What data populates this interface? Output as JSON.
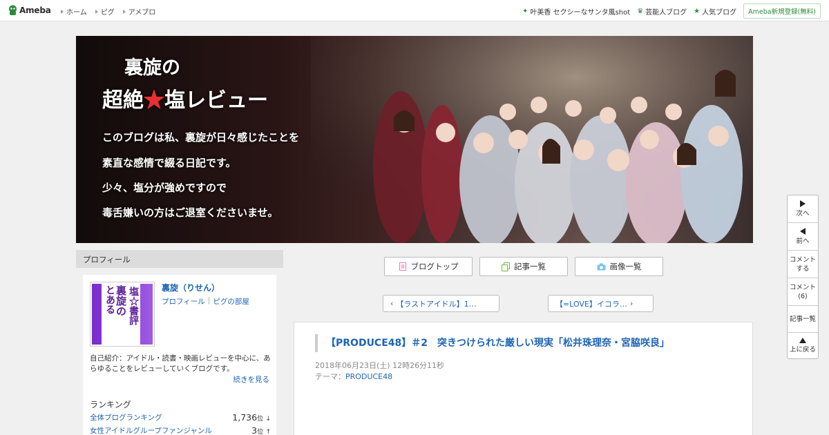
{
  "topbar": {
    "brand": "Ameba",
    "nav": [
      "ホーム",
      "ピグ",
      "アメブロ"
    ],
    "right_links": [
      {
        "icon": "sparkle-icon",
        "label": "叶美香 セクシーなサンタ風shot"
      },
      {
        "icon": "crown-icon",
        "label": "芸能人ブログ"
      },
      {
        "icon": "star-icon",
        "label": "人気ブログ"
      }
    ],
    "register_label": "Ameba新規登録(無料)"
  },
  "header": {
    "title_line1": "裏旋の",
    "title_line2_a": "超絶",
    "title_line2_star": "★",
    "title_line2_b": "塩レビュー",
    "lines": [
      "このブログは私、裏旋が日々感じたことを",
      "素直な感情で綴る日記です。",
      "少々、塩分が強めですので",
      "毒舌嫌いの方はご退室くださいませ。"
    ]
  },
  "sidebar": {
    "heading": "プロフィール",
    "avatar_text_a": "とある",
    "avatar_text_b": "裏旋の",
    "avatar_text_c": "塩☆書評",
    "name": "裏旋（りせん）",
    "link_profile": "プロフィール",
    "link_room": "ピグの部屋",
    "intro": "自己紹介：アイドル・読書・映画レビューを中心に、あらゆることをレビューしていくブログです。",
    "more": "続きを見る",
    "ranking_title": "ランキング",
    "rankings": [
      {
        "label": "全体ブログランキング",
        "value": "1,736",
        "unit": "位",
        "trend": "↓"
      },
      {
        "label": "女性アイドルグループファンジャンル",
        "value": "3",
        "unit": "位",
        "trend": "↑"
      }
    ]
  },
  "main": {
    "buttons": [
      {
        "label": "ブログトップ",
        "icon": "document-icon"
      },
      {
        "label": "記事一覧",
        "icon": "copy-icon"
      },
      {
        "label": "画像一覧",
        "icon": "camera-icon"
      }
    ],
    "prev_label": "【ラストアイドル】1…",
    "next_label": "【=LOVE】イコラ…"
  },
  "article": {
    "title": "【PRODUCE48】＃2　突きつけられた厳しい現実「松井珠理奈・宮脇咲良」",
    "date": "2018年06月23日(土) 12時26分11秒",
    "theme_prefix": "テーマ：",
    "theme": "PRODUCE48"
  },
  "rnav": {
    "next": "次へ",
    "prev": "前へ",
    "comment_line1": "コメント",
    "comment_line2": "する",
    "comments_line1": "コメント",
    "comments_count": "(6)",
    "list": "記事一覧",
    "top": "上に戻る"
  },
  "colors": {
    "link": "#1e64b4",
    "brand_green": "#2d8c3c",
    "header_star": "#e83030",
    "avatar_purple": "#7a2bcf"
  }
}
